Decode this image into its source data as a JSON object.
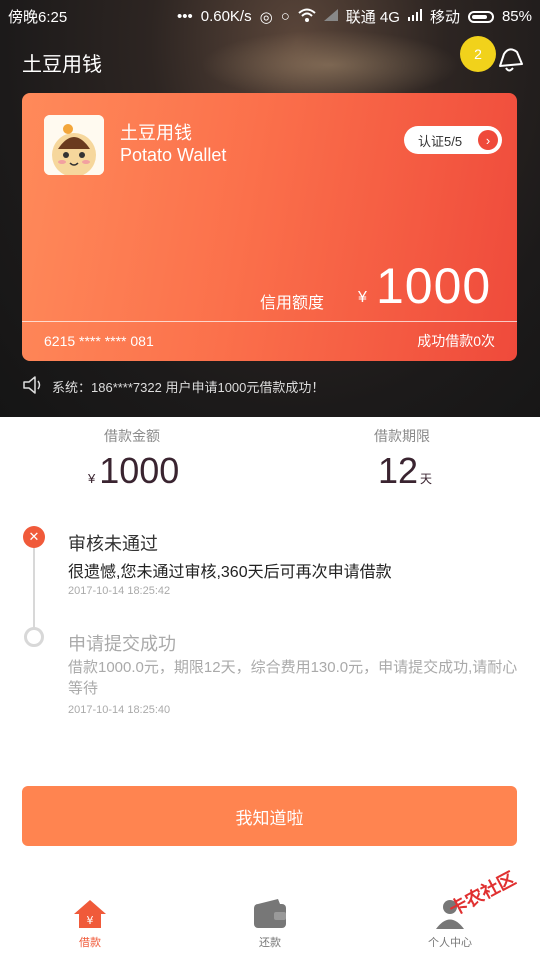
{
  "status_bar": {
    "time": "傍晚6:25",
    "speed": "0.60K/s",
    "carrier1": "联通 4G",
    "carrier2": "移动",
    "battery": "85%"
  },
  "header": {
    "title": "土豆用钱",
    "notification_count": "2"
  },
  "card": {
    "name": "土豆用钱",
    "name_en": "Potato Wallet",
    "verify_label": "认证5/5",
    "credit_label": "信用额度",
    "currency": "¥",
    "credit_amount": "1000",
    "card_number": "6215 **** ****  081",
    "success_text": "成功借款0次"
  },
  "announcement": {
    "text": "系统：186****7322 用户申请1000元借款成功！"
  },
  "loan": {
    "amount_label": "借款金额",
    "currency": "¥",
    "amount": "1000",
    "term_label": "借款期限",
    "term": "12",
    "term_unit": "天"
  },
  "timeline": [
    {
      "title": "审核未通过",
      "desc": "很遗憾,您未通过审核,360天后可再次申请借款",
      "time": "2017-10-14 18:25:42",
      "status": "rejected"
    },
    {
      "title": "申请提交成功",
      "desc": "借款1000.0元，期限12天，综合费用130.0元，申请提交成功,请耐心等待",
      "time": "2017-10-14 18:25:40",
      "status": "done"
    }
  ],
  "confirm_button": "我知道啦",
  "nav": [
    {
      "label": "借款",
      "icon": "home-icon",
      "active": true
    },
    {
      "label": "还款",
      "icon": "wallet-icon",
      "active": false
    },
    {
      "label": "个人中心",
      "icon": "user-icon",
      "active": false
    }
  ],
  "watermark": "卡农社区",
  "colors": {
    "accent": "#ff8450",
    "card_start": "#ff8a5a",
    "card_end": "#ef4a3b",
    "badge": "#f1d21b",
    "error": "#f05a3a",
    "nav_active": "#f05a3a",
    "nav_inactive": "#777777"
  }
}
